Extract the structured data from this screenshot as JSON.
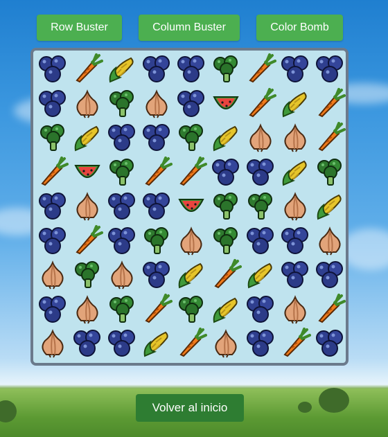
{
  "powerups": {
    "row_buster": "Row Buster",
    "column_buster": "Column Buster",
    "color_bomb": "Color Bomb"
  },
  "back_button": "Volver al inicio",
  "colors": {
    "button_green": "#4caf50",
    "back_green": "#2e7d32",
    "board_bg": "#bfe3ee",
    "board_border": "#6b7a8c"
  },
  "board": [
    [
      "blueberry",
      "carrot",
      "corn",
      "blueberry",
      "blueberry",
      "broccoli",
      "carrot",
      "blueberry",
      "blueberry"
    ],
    [
      "blueberry",
      "onion",
      "broccoli",
      "onion",
      "blueberry",
      "watermelon",
      "carrot",
      "corn",
      "carrot"
    ],
    [
      "broccoli",
      "corn",
      "blueberry",
      "blueberry",
      "broccoli",
      "corn",
      "onion",
      "onion",
      "carrot"
    ],
    [
      "carrot",
      "watermelon",
      "broccoli",
      "carrot",
      "carrot",
      "blueberry",
      "blueberry",
      "corn",
      "broccoli"
    ],
    [
      "blueberry",
      "onion",
      "blueberry",
      "blueberry",
      "watermelon",
      "broccoli",
      "broccoli",
      "onion",
      "corn"
    ],
    [
      "blueberry",
      "carrot",
      "blueberry",
      "broccoli",
      "onion",
      "broccoli",
      "blueberry",
      "blueberry",
      "onion"
    ],
    [
      "onion",
      "broccoli",
      "onion",
      "blueberry",
      "corn",
      "carrot",
      "corn",
      "blueberry",
      "blueberry"
    ],
    [
      "blueberry",
      "onion",
      "broccoli",
      "carrot",
      "broccoli",
      "corn",
      "blueberry",
      "onion",
      "carrot"
    ],
    [
      "onion",
      "blueberry",
      "blueberry",
      "corn",
      "carrot",
      "onion",
      "blueberry",
      "carrot",
      "blueberry"
    ]
  ]
}
